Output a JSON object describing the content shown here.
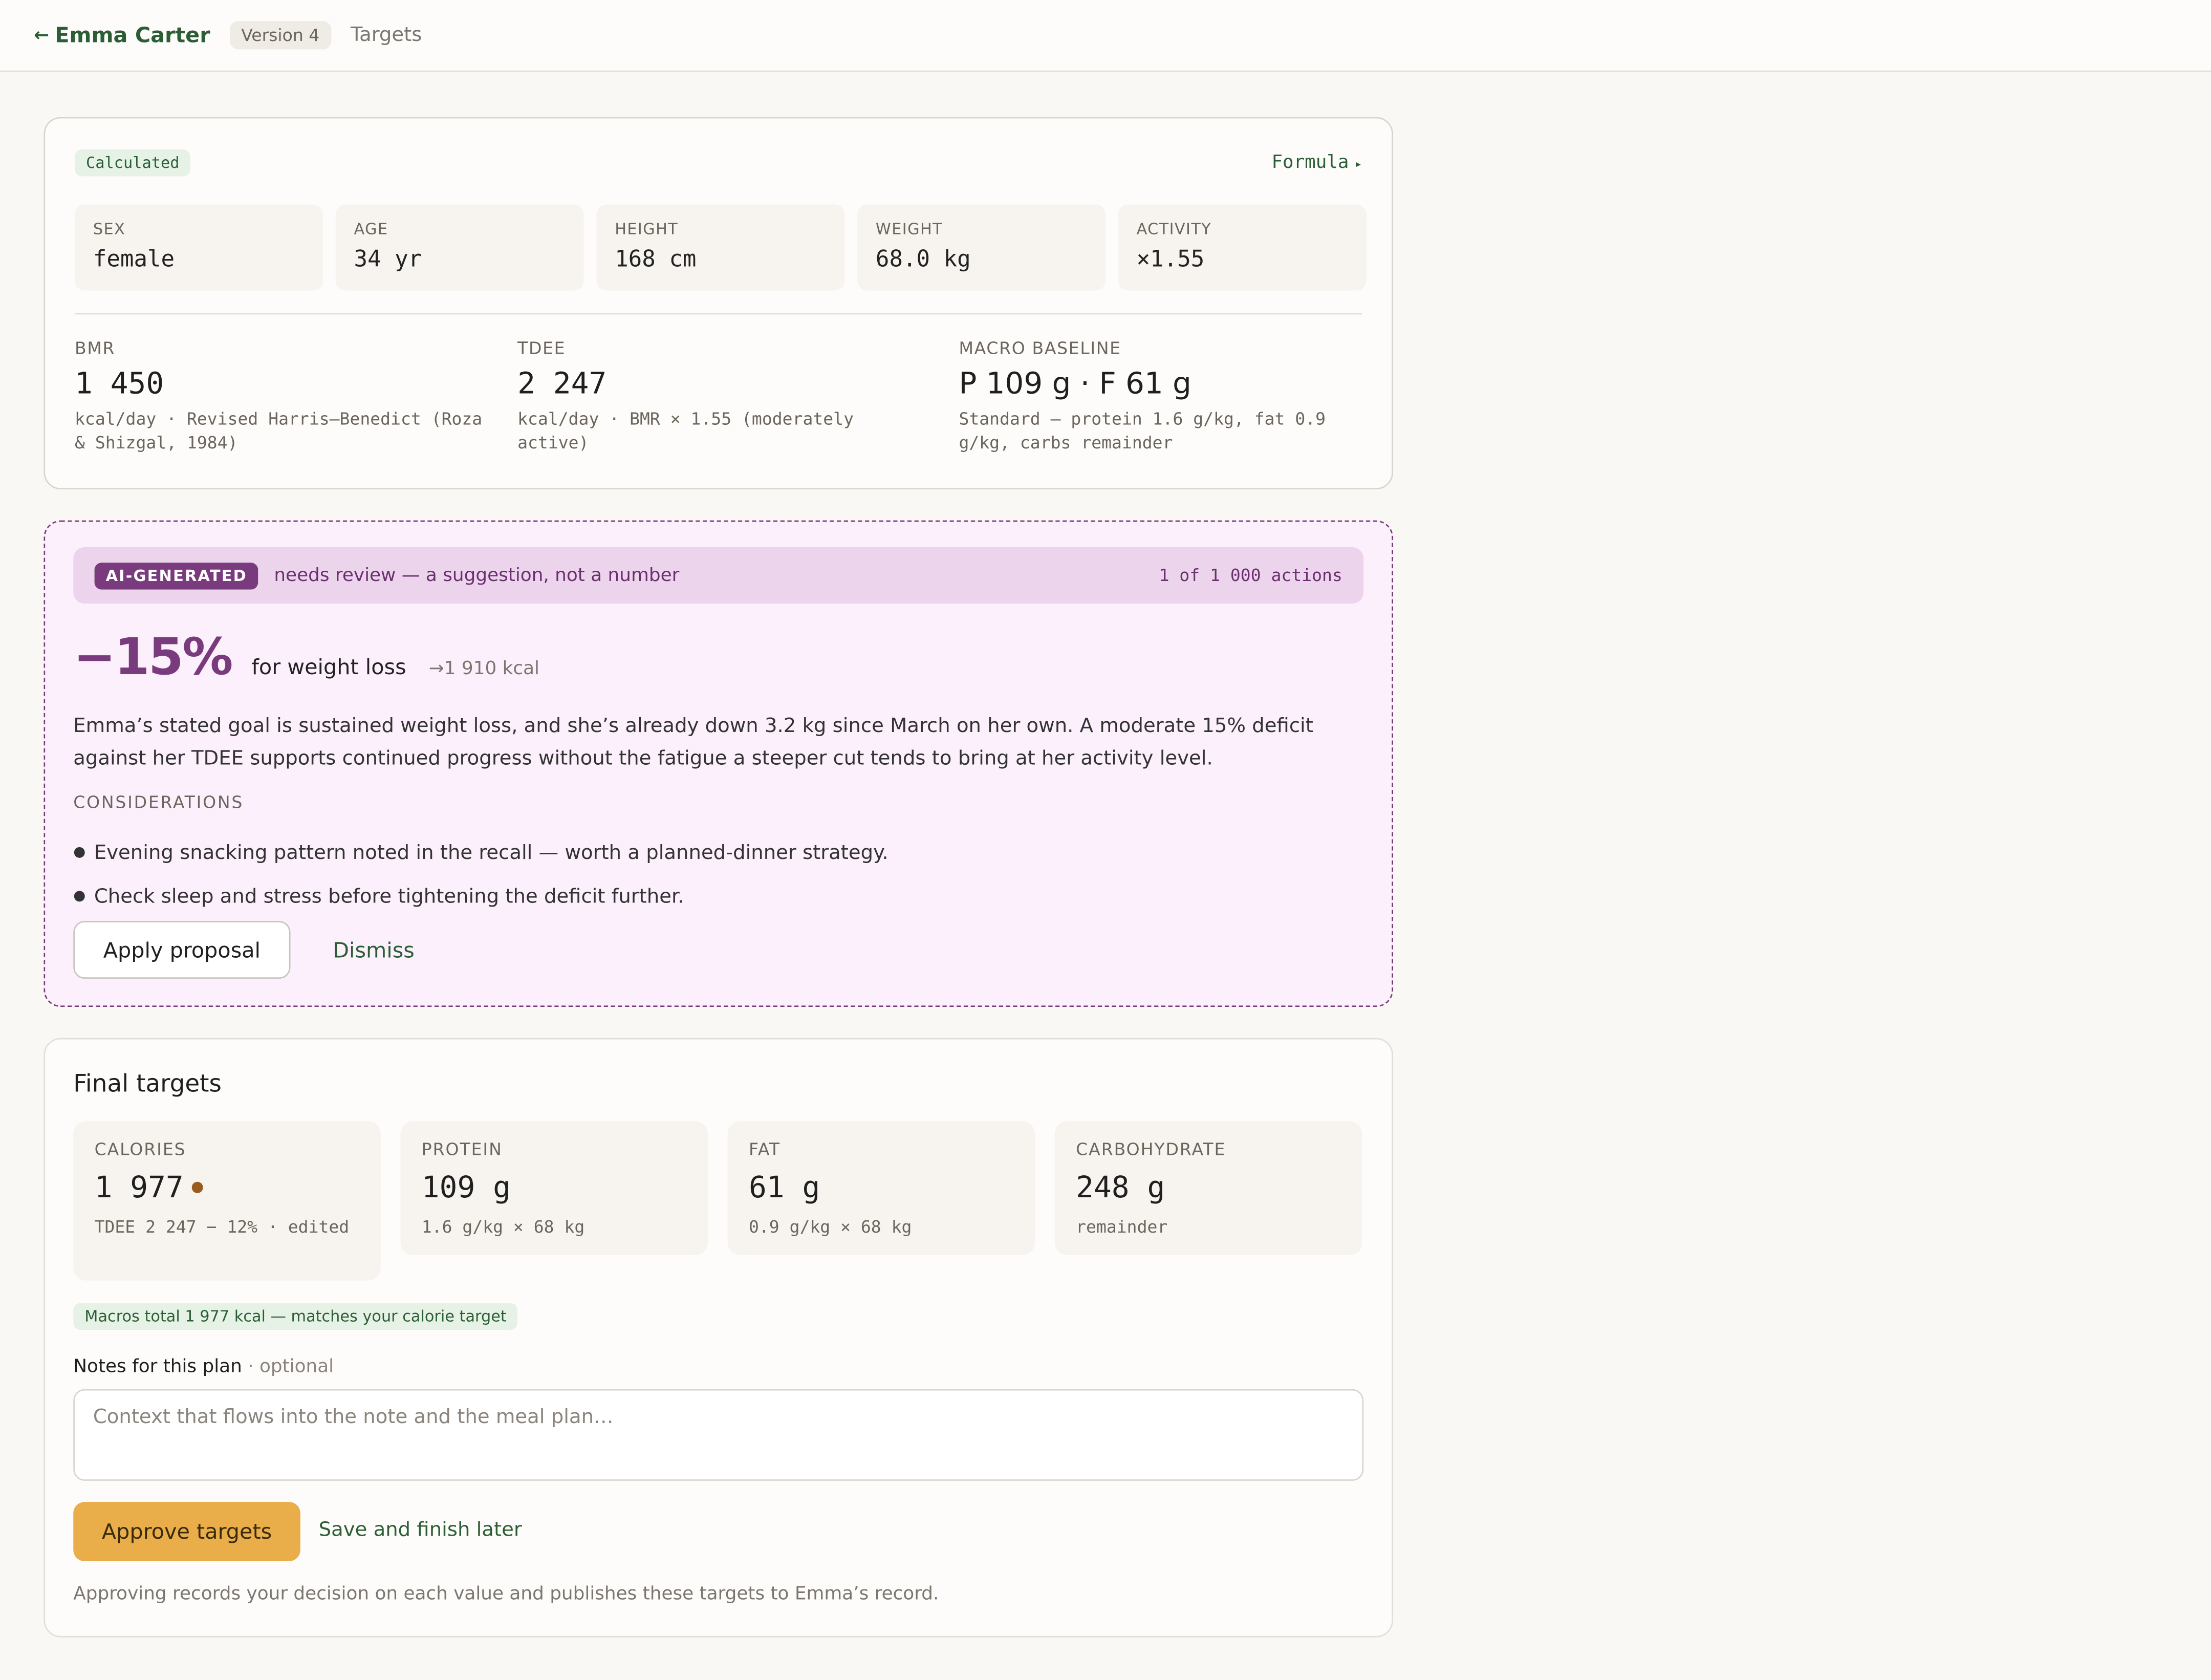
{
  "topbar": {
    "back_label": "Emma Carter",
    "version": "Version 4",
    "crumb": "Targets"
  },
  "calculated": {
    "badge": "Calculated",
    "formula_link": "Formula",
    "stats": [
      {
        "label": "SEX",
        "value": "female"
      },
      {
        "label": "AGE",
        "value": "34 yr"
      },
      {
        "label": "HEIGHT",
        "value": "168 cm"
      },
      {
        "label": "WEIGHT",
        "value": "68.0 kg"
      },
      {
        "label": "ACTIVITY",
        "value": "×1.55"
      }
    ],
    "bmr": {
      "label": "BMR",
      "value": "1 450",
      "sub": "kcal/day · Revised Harris–Benedict (Roza & Shizgal, 1984)"
    },
    "tdee": {
      "label": "TDEE",
      "value": "2 247",
      "sub": "kcal/day · BMR × 1.55 (moderately active)"
    },
    "macro": {
      "label": "MACRO BASELINE",
      "value": "P 109 g · F 61 g",
      "sub": "Standard — protein 1.6 g/kg, fat 0.9 g/kg, carbs remainder"
    }
  },
  "ai": {
    "tag": "AI-GENERATED",
    "note": "needs review — a suggestion, not a number",
    "count": "1 of 1 000 actions",
    "percent": "−15%",
    "goal": "for weight loss",
    "kcal": "→1 910 kcal",
    "body": "Emma’s stated goal is sustained weight loss, and she’s already down 3.2 kg since March on her own. A moderate 15% deficit against her TDEE supports continued progress without the fatigue a steeper cut tends to bring at her activity level.",
    "considerations_label": "CONSIDERATIONS",
    "considerations": [
      "Evening snacking pattern noted in the recall — worth a planned-dinner strategy.",
      "Check sleep and stress before tightening the deficit further."
    ],
    "apply_label": "Apply proposal",
    "dismiss_label": "Dismiss"
  },
  "final": {
    "title": "Final targets",
    "targets": [
      {
        "label": "CALORIES",
        "value": "1 977",
        "sub": "TDEE 2 247 − 12% · edited"
      },
      {
        "label": "PROTEIN",
        "value": "109 g",
        "sub": "1.6 g/kg × 68 kg"
      },
      {
        "label": "FAT",
        "value": "61 g",
        "sub": "0.9 g/kg × 68 kg"
      },
      {
        "label": "CARBOHYDRATE",
        "value": "248 g",
        "sub": "remainder"
      }
    ],
    "macro_check": "Macros total 1 977 kcal — matches your calorie target",
    "notes_label": "Notes for this plan",
    "notes_optional": "· optional",
    "notes_placeholder": "Context that flows into the note and the meal plan…",
    "approve_label": "Approve targets",
    "later_label": "Save and finish later",
    "footnote": "Approving records your decision on each value and publishes these targets to Emma’s record."
  },
  "colors": {
    "brand_green": "#2c5e35",
    "ai_purple": "#7a3b7e",
    "approve_amber": "#e9ad4a",
    "edited_dot": "#9a5c1c"
  },
  "icons": {
    "back": "arrow-left-icon",
    "formula": "triangle-right-icon",
    "edited": "dot-icon"
  }
}
